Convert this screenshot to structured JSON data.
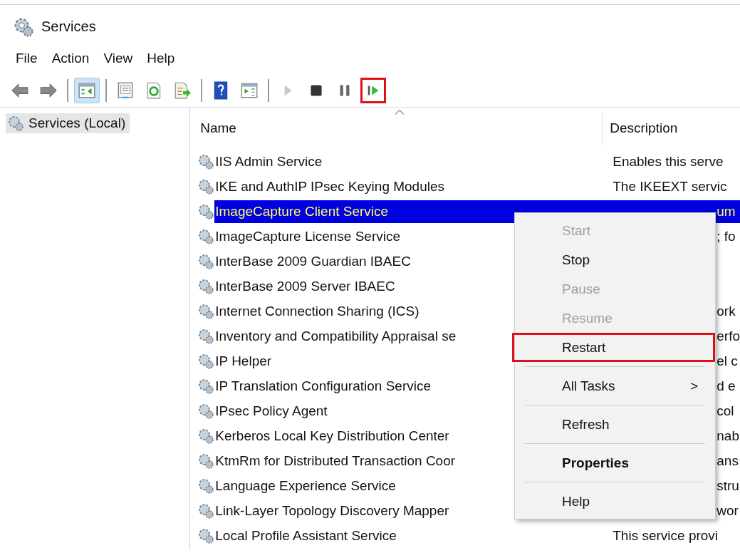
{
  "window": {
    "title": "Services"
  },
  "menu_bar": [
    "File",
    "Action",
    "View",
    "Help"
  ],
  "toolbar": [
    {
      "kind": "back",
      "disabled": false,
      "selected": false,
      "highlighted": false
    },
    {
      "kind": "forward",
      "disabled": false,
      "selected": false,
      "highlighted": false
    },
    {
      "kind": "sep"
    },
    {
      "kind": "tree",
      "disabled": false,
      "selected": true,
      "highlighted": false
    },
    {
      "kind": "sep"
    },
    {
      "kind": "properties",
      "disabled": false,
      "selected": false,
      "highlighted": false
    },
    {
      "kind": "refresh",
      "disabled": false,
      "selected": false,
      "highlighted": false
    },
    {
      "kind": "export",
      "disabled": false,
      "selected": false,
      "highlighted": false
    },
    {
      "kind": "sep"
    },
    {
      "kind": "help",
      "disabled": false,
      "selected": false,
      "highlighted": false
    },
    {
      "kind": "pane",
      "disabled": false,
      "selected": false,
      "highlighted": false
    },
    {
      "kind": "sep"
    },
    {
      "kind": "play",
      "disabled": true,
      "selected": false,
      "highlighted": false
    },
    {
      "kind": "stop",
      "disabled": false,
      "selected": false,
      "highlighted": false
    },
    {
      "kind": "pause",
      "disabled": false,
      "selected": false,
      "highlighted": false
    },
    {
      "kind": "restart",
      "disabled": false,
      "selected": false,
      "highlighted": true
    }
  ],
  "tree": {
    "items": [
      {
        "label": "Services (Local)",
        "selected": true
      }
    ]
  },
  "table": {
    "columns": [
      "Name",
      "Description"
    ],
    "rows": [
      {
        "name": "IIS Admin Service",
        "description": "Enables this serve",
        "selected": false,
        "covered": false
      },
      {
        "name": "IKE and AuthIP IPsec Keying Modules",
        "description": "The IKEEXT servic",
        "selected": false,
        "covered": false
      },
      {
        "name": "ImageCapture Client Service",
        "description": "um",
        "selected": true,
        "covered": true
      },
      {
        "name": "ImageCapture License Service",
        "description": "; fo",
        "selected": false,
        "covered": true
      },
      {
        "name": "InterBase 2009 Guardian IBAEC",
        "selected": false,
        "covered": true
      },
      {
        "name": "InterBase 2009 Server IBAEC",
        "selected": false,
        "covered": true
      },
      {
        "name": "Internet Connection Sharing (ICS)",
        "description": "ork",
        "selected": false,
        "covered": true
      },
      {
        "name": "Inventory and Compatibility Appraisal se",
        "description": "erfo",
        "selected": false,
        "covered": true
      },
      {
        "name": "IP Helper",
        "description": "el c",
        "selected": false,
        "covered": true
      },
      {
        "name": "IP Translation Configuration Service",
        "description": "d e",
        "selected": false,
        "covered": true
      },
      {
        "name": "IPsec Policy Agent",
        "description": "col",
        "selected": false,
        "covered": true
      },
      {
        "name": "Kerberos Local Key Distribution Center",
        "description": "nab",
        "selected": false,
        "covered": true
      },
      {
        "name": "KtmRm for Distributed Transaction Coor",
        "description": "ans",
        "selected": false,
        "covered": true
      },
      {
        "name": "Language Experience Service",
        "description": "stru",
        "selected": false,
        "covered": true
      },
      {
        "name": "Link-Layer Topology Discovery Mapper",
        "description": "wor",
        "selected": false,
        "covered": true
      },
      {
        "name": "Local Profile Assistant Service",
        "description": "This service provi",
        "selected": false,
        "covered": false
      }
    ]
  },
  "context_menu": {
    "items": [
      {
        "kind": "item",
        "label": "Start",
        "disabled": true,
        "bold": false,
        "highlighted": false
      },
      {
        "kind": "item",
        "label": "Stop",
        "disabled": false,
        "bold": false,
        "highlighted": false
      },
      {
        "kind": "item",
        "label": "Pause",
        "disabled": true,
        "bold": false,
        "highlighted": false
      },
      {
        "kind": "item",
        "label": "Resume",
        "disabled": true,
        "bold": false,
        "highlighted": false
      },
      {
        "kind": "item",
        "label": "Restart",
        "disabled": false,
        "bold": false,
        "highlighted": true
      },
      {
        "kind": "sep"
      },
      {
        "kind": "submenu",
        "label": "All Tasks",
        "arrow": ">",
        "disabled": false,
        "bold": false,
        "highlighted": false
      },
      {
        "kind": "sep"
      },
      {
        "kind": "item",
        "label": "Refresh",
        "disabled": false,
        "bold": false,
        "highlighted": false
      },
      {
        "kind": "sep"
      },
      {
        "kind": "item",
        "label": "Properties",
        "disabled": false,
        "bold": true,
        "highlighted": false
      },
      {
        "kind": "sep"
      },
      {
        "kind": "item",
        "label": "Help",
        "disabled": false,
        "bold": false,
        "highlighted": false
      }
    ]
  }
}
